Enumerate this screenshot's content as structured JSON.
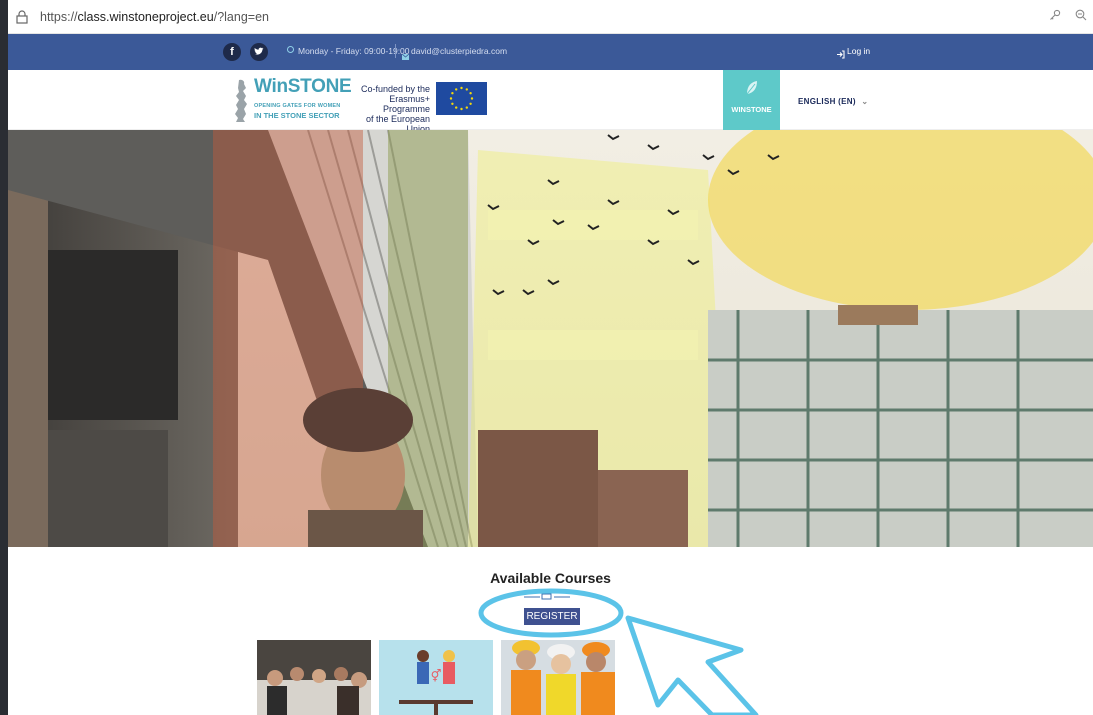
{
  "browser": {
    "url_prefix": "https://",
    "url_domain": "class.winstoneproject.eu",
    "url_path": "/?lang=en"
  },
  "topbar": {
    "facebook": "f",
    "twitter": "t",
    "hours": "Monday - Friday: 09:00-19:00",
    "email": "david@clusterpiedra.com",
    "login": "Log in"
  },
  "header": {
    "logo_title": "WinSTONE",
    "logo_sub1": "OPENING GATES FOR WOMEN",
    "logo_sub2": "IN THE STONE SECTOR",
    "cofund_line1": "Co-funded by the",
    "cofund_line2": "Erasmus+ Programme",
    "cofund_line3": "of the European Union",
    "brand_tab": "WINSTONE",
    "language": "ENGLISH (EN)"
  },
  "courses": {
    "title": "Available Courses",
    "register": "REGISTER"
  },
  "colors": {
    "topbar": "#3b5998",
    "teal": "#5ec9c9",
    "register": "#3f5190",
    "annotation": "#5bc3e8"
  }
}
